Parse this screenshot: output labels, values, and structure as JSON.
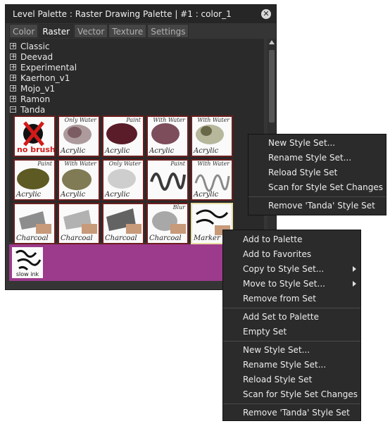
{
  "window": {
    "title": "Level Palette : Raster Drawing Palette | #1 : color_1"
  },
  "tabs": [
    {
      "label": "Color"
    },
    {
      "label": "Raster"
    },
    {
      "label": "Vector"
    },
    {
      "label": "Texture"
    },
    {
      "label": "Settings"
    }
  ],
  "tree": [
    {
      "label": "Classic",
      "expander": "+"
    },
    {
      "label": "Deevad",
      "expander": "+"
    },
    {
      "label": "Experimental",
      "expander": "+"
    },
    {
      "label": "Kaerhon_v1",
      "expander": "+"
    },
    {
      "label": "Mojo_v1",
      "expander": "+"
    },
    {
      "label": "Ramon",
      "expander": "+"
    },
    {
      "label": "Tanda",
      "expander": "−"
    }
  ],
  "brushes": [
    {
      "label": "",
      "tag": "",
      "nobrush": "no brush"
    },
    {
      "label": "Acrylic",
      "tag": "Only Water"
    },
    {
      "label": "Acrylic",
      "tag": "Paint"
    },
    {
      "label": "Acrylic",
      "tag": "With Water"
    },
    {
      "label": "Acrylic",
      "tag": "With Water"
    },
    {
      "label": "Acrylic",
      "tag": "Paint"
    },
    {
      "label": "Acrylic",
      "tag": "With Water"
    },
    {
      "label": "Acrylic",
      "tag": "Only Water"
    },
    {
      "label": "",
      "tag": "Paint"
    },
    {
      "label": "Acrylic",
      "tag": "With Water"
    },
    {
      "label": "Charcoal",
      "tag": ""
    },
    {
      "label": "Charcoal",
      "tag": ""
    },
    {
      "label": "Charcoal",
      "tag": ""
    },
    {
      "label": "Charcoal",
      "tag": "Blur"
    },
    {
      "label": "Marker",
      "tag": ""
    }
  ],
  "preview": {
    "label": "slow ink",
    "color": "#9c3a8c"
  },
  "menu_style_set": [
    {
      "label": "New Style Set..."
    },
    {
      "label": "Rename Style Set..."
    },
    {
      "label": "Reload Style Set"
    },
    {
      "label": "Scan for Style Set Changes"
    },
    {
      "label": "Remove 'Tanda' Style Set"
    }
  ],
  "menu_style": {
    "group1": [
      {
        "label": "Add to Palette"
      },
      {
        "label": "Add to Favorites"
      },
      {
        "label": "Copy to Style Set...",
        "submenu": true
      },
      {
        "label": "Move to Style Set...",
        "submenu": true
      },
      {
        "label": "Remove from Set"
      }
    ],
    "group2": [
      {
        "label": "Add Set to Palette"
      },
      {
        "label": "Empty Set"
      }
    ],
    "group3": [
      {
        "label": "New Style Set..."
      },
      {
        "label": "Rename Style Set..."
      },
      {
        "label": "Reload Style Set"
      },
      {
        "label": "Scan for Style Set Changes"
      }
    ],
    "group4": [
      {
        "label": "Remove 'Tanda' Style Set"
      }
    ]
  }
}
